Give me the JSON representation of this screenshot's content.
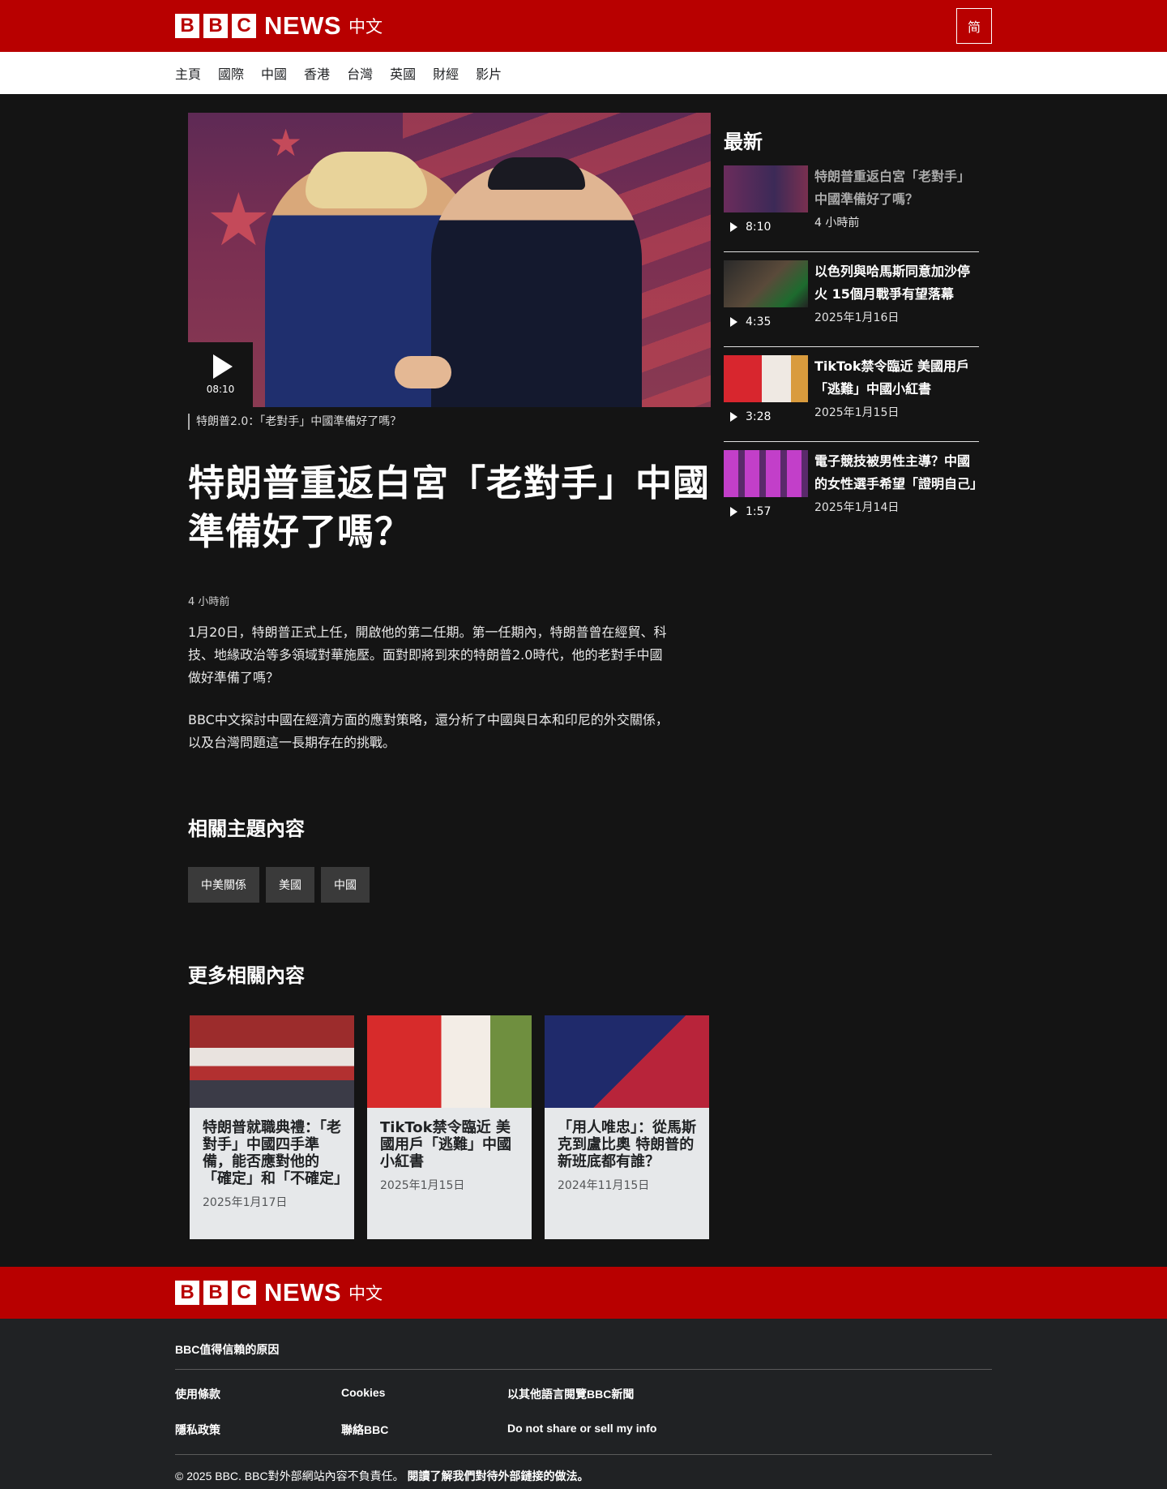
{
  "header": {
    "blocks": [
      "B",
      "B",
      "C"
    ],
    "news_label": "NEWS",
    "lang_label": "中文",
    "script_toggle": "简"
  },
  "nav": {
    "items": [
      "主頁",
      "國際",
      "中國",
      "香港",
      "台灣",
      "英國",
      "財經",
      "影片"
    ]
  },
  "hero": {
    "duration": "08:10",
    "caption": "特朗普2.0：「老對手」中國準備好了嗎？"
  },
  "article": {
    "title": "特朗普重返白宮「老對手」中國準備好了嗎？",
    "time": "4 小時前",
    "paragraphs": [
      "1月20日，特朗普正式上任，開啟他的第二任期。第一任期內，特朗普曾在經貿、科技、地緣政治等多領域對華施壓。面對即將到來的特朗普2.0時代，他的老對手中國做好準備了嗎？",
      "BBC中文探討中國在經濟方面的應對策略，還分析了中國與日本和印尼的外交關係，以及台灣問題這一長期存在的挑戰。"
    ]
  },
  "related_topics": {
    "heading": "相關主題內容",
    "tags": [
      "中美關係",
      "美國",
      "中國"
    ]
  },
  "more_related": {
    "heading": "更多相關內容",
    "cards": [
      {
        "title": "特朗普就職典禮：「老對手」中國四手準備，能否應對他的「確定」和「不確定」",
        "date": "2025年1月17日"
      },
      {
        "title": "TikTok禁令臨近 美國用戶「逃難」中國小紅書",
        "date": "2025年1月15日"
      },
      {
        "title": "「用人唯忠」：從馬斯克到盧比奧 特朗普的新班底都有誰？",
        "date": "2024年11月15日"
      }
    ]
  },
  "latest": {
    "heading": "最新",
    "items": [
      {
        "title": "特朗普重返白宮「老對手」中國準備好了嗎？",
        "duration": "8:10",
        "date": "4 小時前"
      },
      {
        "title": "以色列與哈馬斯同意加沙停火 15個月戰爭有望落幕",
        "duration": "4:35",
        "date": "2025年1月16日"
      },
      {
        "title": "TikTok禁令臨近 美國用戶「逃難」中國小紅書",
        "duration": "3:28",
        "date": "2025年1月15日"
      },
      {
        "title": "電子競技被男性主導？中國的女性選手希望「證明自己」",
        "duration": "1:57",
        "date": "2025年1月14日"
      }
    ]
  },
  "footer": {
    "trust": "BBC值得信賴的原因",
    "links": [
      "使用條款",
      "Cookies",
      "以其他語言閱覽BBC新聞",
      "隱私政策",
      "聯絡BBC",
      "Do not share or sell my info"
    ],
    "copyright": "© 2025 BBC. BBC對外部網站內容不負責任。",
    "external_link": "閱讀了解我們對待外部鏈接的做法。"
  },
  "colors": {
    "brand_red": "#b80000",
    "page_bg": "#141414",
    "card_bg": "#e6e8ea",
    "footer_bg": "#202224"
  }
}
